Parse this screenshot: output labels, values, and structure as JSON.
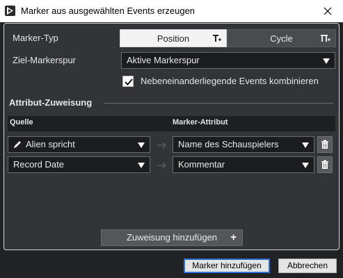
{
  "window": {
    "title": "Marker aus ausgewählten Events erzeugen",
    "icons": {
      "app": "app-logo-icon",
      "close": "close-icon"
    }
  },
  "marker_type": {
    "label": "Marker-Typ",
    "options": [
      "Position",
      "Cycle"
    ],
    "selected": "Position"
  },
  "target_track": {
    "label": "Ziel-Markerspur",
    "value": "Aktive Markerspur"
  },
  "combine": {
    "label": "Nebeneinanderliegende Events kombinieren",
    "checked": true
  },
  "assignment": {
    "section_title": "Attribut-Zuweisung",
    "col_source": "Quelle",
    "col_attribute": "Marker-Attribut",
    "rows": [
      {
        "source": "Alien spricht",
        "source_icon": "pencil-icon",
        "attribute": "Name des Schauspielers"
      },
      {
        "source": "Record Date",
        "attribute": "Kommentar"
      }
    ],
    "add_button": "Zuweisung hinzufügen",
    "add_icon": "+"
  },
  "footer": {
    "ok_label": "Marker hinzufügen",
    "cancel_label": "Abbrechen"
  },
  "colors": {
    "background": "#212224",
    "panel": "#333437",
    "accent_border": "#2f6fd6"
  }
}
